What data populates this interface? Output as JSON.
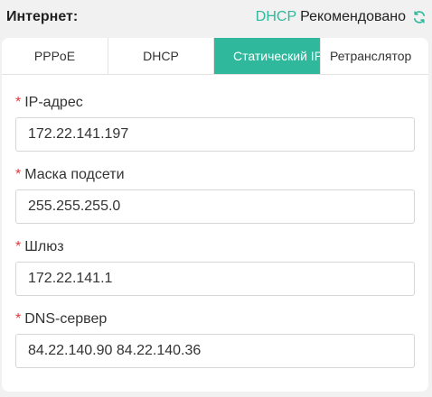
{
  "header": {
    "label": "Интернет:",
    "mode": "DHCP",
    "recommended": "Рекомендовано",
    "refresh_icon": "refresh-icon"
  },
  "tabs": [
    {
      "label": "PPPoE",
      "active": false
    },
    {
      "label": "DHCP",
      "active": false
    },
    {
      "label": "Статический IP",
      "active": true
    },
    {
      "label": "Ретранслятор",
      "active": false
    }
  ],
  "fields": {
    "ip": {
      "required_mark": "*",
      "label": "IP-адрес",
      "value": "172.22.141.197"
    },
    "mask": {
      "required_mark": "*",
      "label": "Маска подсети",
      "value": "255.255.255.0"
    },
    "gateway": {
      "required_mark": "*",
      "label": "Шлюз",
      "value": "172.22.141.1"
    },
    "dns": {
      "required_mark": "*",
      "label": "DNS-сервер",
      "value": "84.22.140.90 84.22.140.36"
    }
  },
  "colors": {
    "accent": "#2fb89b",
    "required": "#e4393c"
  }
}
